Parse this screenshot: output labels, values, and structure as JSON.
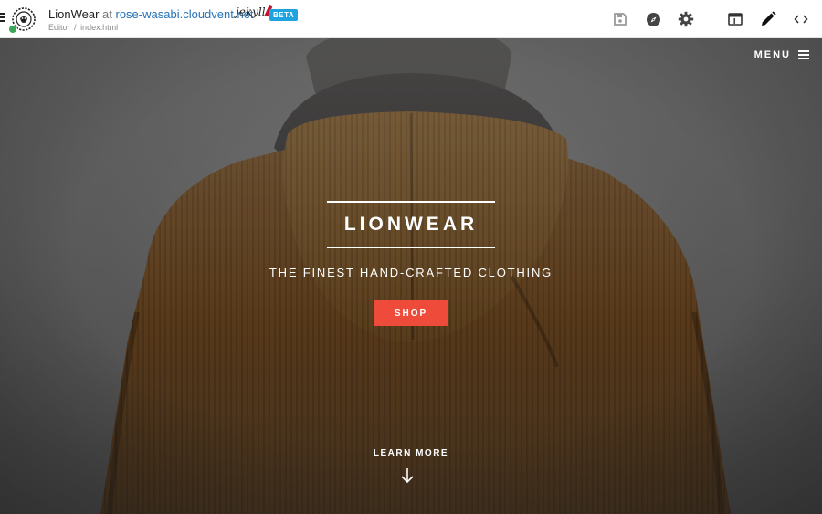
{
  "editor": {
    "site_name": "LionWear",
    "at": "at",
    "domain": "rose-wasabi.cloudvent.net",
    "generator": "Jekyll",
    "beta_badge": "BETA",
    "breadcrumb": [
      "Editor",
      "index.html"
    ],
    "breadcrumb_sep": "/",
    "tools": [
      "save-icon",
      "compass-icon",
      "gear-icon",
      "layout-icon",
      "pencil-icon",
      "code-icon"
    ]
  },
  "hero": {
    "menu_label": "MENU",
    "title": "LIONWEAR",
    "tagline": "THE FINEST HAND-CRAFTED CLOTHING",
    "shop_label": "SHOP",
    "learn_more": "LEARN MORE"
  },
  "colors": {
    "accent": "#ee4b3a",
    "link": "#2573b8",
    "beta": "#1ea3de",
    "status_ok": "#3aa757"
  }
}
